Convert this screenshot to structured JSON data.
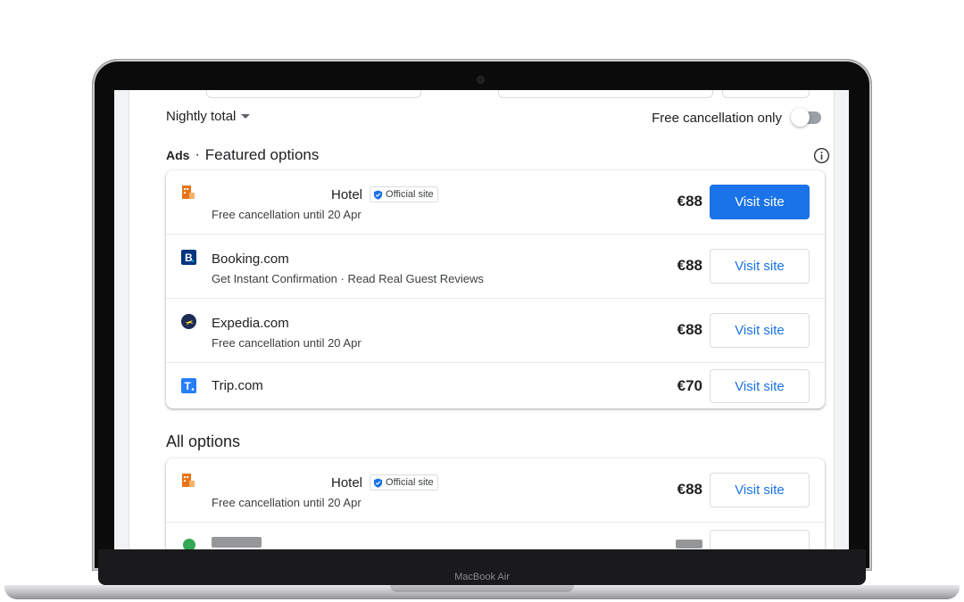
{
  "device": {
    "label": "MacBook Air"
  },
  "filters": {
    "sort_label": "Nightly total",
    "free_cancellation_label": "Free cancellation only",
    "free_cancellation_on": false
  },
  "featured": {
    "ads_label": "Ads",
    "separator": "·",
    "title": "Featured options",
    "rows": [
      {
        "name": "Hotel",
        "badge": "Official site",
        "subtitle": "Free cancellation until 20 Apr",
        "price": "€88",
        "button": "Visit site",
        "logo": "hotel-logo-icon"
      },
      {
        "name": "Booking.com",
        "subtitle": "Get Instant Confirmation · Read Real Guest Reviews",
        "price": "€88",
        "button": "Visit site",
        "logo": "booking-logo-icon"
      },
      {
        "name": "Expedia.com",
        "subtitle": "Free cancellation until 20 Apr",
        "price": "€88",
        "button": "Visit site",
        "logo": "expedia-logo-icon"
      },
      {
        "name": "Trip.com",
        "price": "€70",
        "button": "Visit site",
        "logo": "trip-logo-icon"
      }
    ]
  },
  "all_options": {
    "title": "All options",
    "rows": [
      {
        "name": "Hotel",
        "badge": "Official site",
        "subtitle": "Free cancellation until 20 Apr",
        "price": "€88",
        "button": "Visit site",
        "logo": "hotel-logo-icon"
      }
    ]
  },
  "colors": {
    "accent": "#1a73e8",
    "booking": "#003580",
    "expedia": "#1d2c54",
    "trip": "#287dfa",
    "hotel": "#e8751a"
  }
}
